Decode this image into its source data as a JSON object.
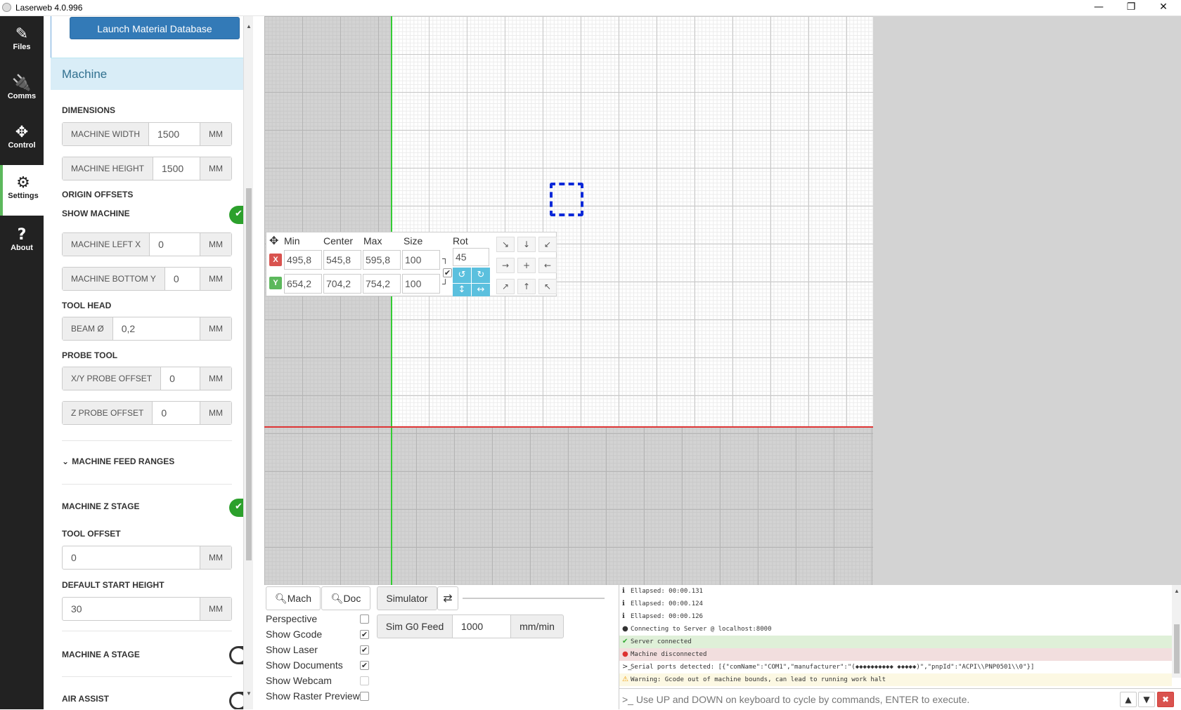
{
  "window": {
    "title": "Laserweb 4.0.996",
    "minimize": "—",
    "restore": "❐",
    "close": "✕"
  },
  "nav": [
    {
      "label": "Files",
      "icon": "✎"
    },
    {
      "label": "Comms",
      "icon": "🔌"
    },
    {
      "label": "Control",
      "icon": "✥"
    },
    {
      "label": "Settings",
      "icon": "⚙"
    },
    {
      "label": "About",
      "icon": "?"
    }
  ],
  "settings": {
    "launch_button": "Launch Material Database",
    "machine_header": "Machine",
    "dimensions": "DIMENSIONS",
    "machine_width": {
      "label": "MACHINE WIDTH",
      "value": "1500",
      "unit": "MM"
    },
    "machine_height": {
      "label": "MACHINE HEIGHT",
      "value": "1500",
      "unit": "MM"
    },
    "origin_offsets": "ORIGIN OFFSETS",
    "show_machine": {
      "label": "SHOW MACHINE",
      "on": true
    },
    "machine_left_x": {
      "label": "MACHINE LEFT X",
      "value": "0",
      "unit": "MM"
    },
    "machine_bottom_y": {
      "label": "MACHINE BOTTOM Y",
      "value": "0",
      "unit": "MM"
    },
    "tool_head": "TOOL HEAD",
    "beam": {
      "label": "BEAM Ø",
      "value": "0,2",
      "unit": "MM"
    },
    "probe_tool": "PROBE TOOL",
    "xy_probe": {
      "label": "X/Y PROBE OFFSET",
      "value": "0",
      "unit": "MM"
    },
    "z_probe": {
      "label": "Z PROBE OFFSET",
      "value": "0",
      "unit": "MM"
    },
    "feed_ranges": "MACHINE FEED RANGES",
    "z_stage": {
      "label": "MACHINE Z STAGE",
      "on": true
    },
    "tool_offset": {
      "label": "TOOL OFFSET",
      "value": "0",
      "unit": "MM"
    },
    "start_height": {
      "label": "DEFAULT START HEIGHT",
      "value": "30",
      "unit": "MM"
    },
    "a_stage": {
      "label": "MACHINE A STAGE",
      "on": false
    },
    "air_assist": {
      "label": "AIR ASSIST",
      "on": false
    }
  },
  "transform": {
    "headers": {
      "min": "Min",
      "center": "Center",
      "max": "Max",
      "size": "Size",
      "rot": "Rot"
    },
    "x": {
      "label": "X",
      "min": "495,8",
      "center": "545,8",
      "max": "595,8",
      "size": "100"
    },
    "y": {
      "label": "Y",
      "min": "654,2",
      "center": "704,2",
      "max": "754,2",
      "size": "100"
    },
    "rot": "45"
  },
  "bottom": {
    "mach": "Mach",
    "doc": "Doc",
    "options": [
      {
        "label": "Perspective",
        "checked": false
      },
      {
        "label": "Show Gcode",
        "checked": true
      },
      {
        "label": "Show Laser",
        "checked": true
      },
      {
        "label": "Show Documents",
        "checked": true
      },
      {
        "label": "Show Webcam",
        "checked": false
      },
      {
        "label": "Show Raster Preview",
        "checked": false
      }
    ],
    "simulator": "Simulator",
    "sim_feed_label": "Sim G0 Feed",
    "sim_feed_value": "1000",
    "sim_feed_unit": "mm/min"
  },
  "console": {
    "lines": [
      {
        "type": "info",
        "icon": "ℹ",
        "text": "Ellapsed: 00:00.131"
      },
      {
        "type": "info",
        "icon": "ℹ",
        "text": "Ellapsed: 00:00.124"
      },
      {
        "type": "info",
        "icon": "ℹ",
        "text": "Ellapsed: 00:00.126"
      },
      {
        "type": "info",
        "icon": "●",
        "text": "Connecting to Server @ localhost:8000"
      },
      {
        "type": "ok",
        "icon": "✔",
        "text": "Server connected"
      },
      {
        "type": "err",
        "icon": "●",
        "text": "Machine disconnected"
      },
      {
        "type": "info",
        "icon": ">_",
        "text": "Serial ports detected: [{\"comName\":\"COM1\",\"manufacturer\":\"(◆◆◆◆◆◆◆◆◆◆ ◆◆◆◆◆)\",\"pnpId\":\"ACPI\\\\PNP0501\\\\0\"}]"
      },
      {
        "type": "warn",
        "icon": "⚠",
        "text": "Warning: Gcode out of machine bounds, can lead to running work halt"
      }
    ],
    "placeholder": "Use UP and DOWN on keyboard to cycle by commands, ENTER to execute."
  }
}
